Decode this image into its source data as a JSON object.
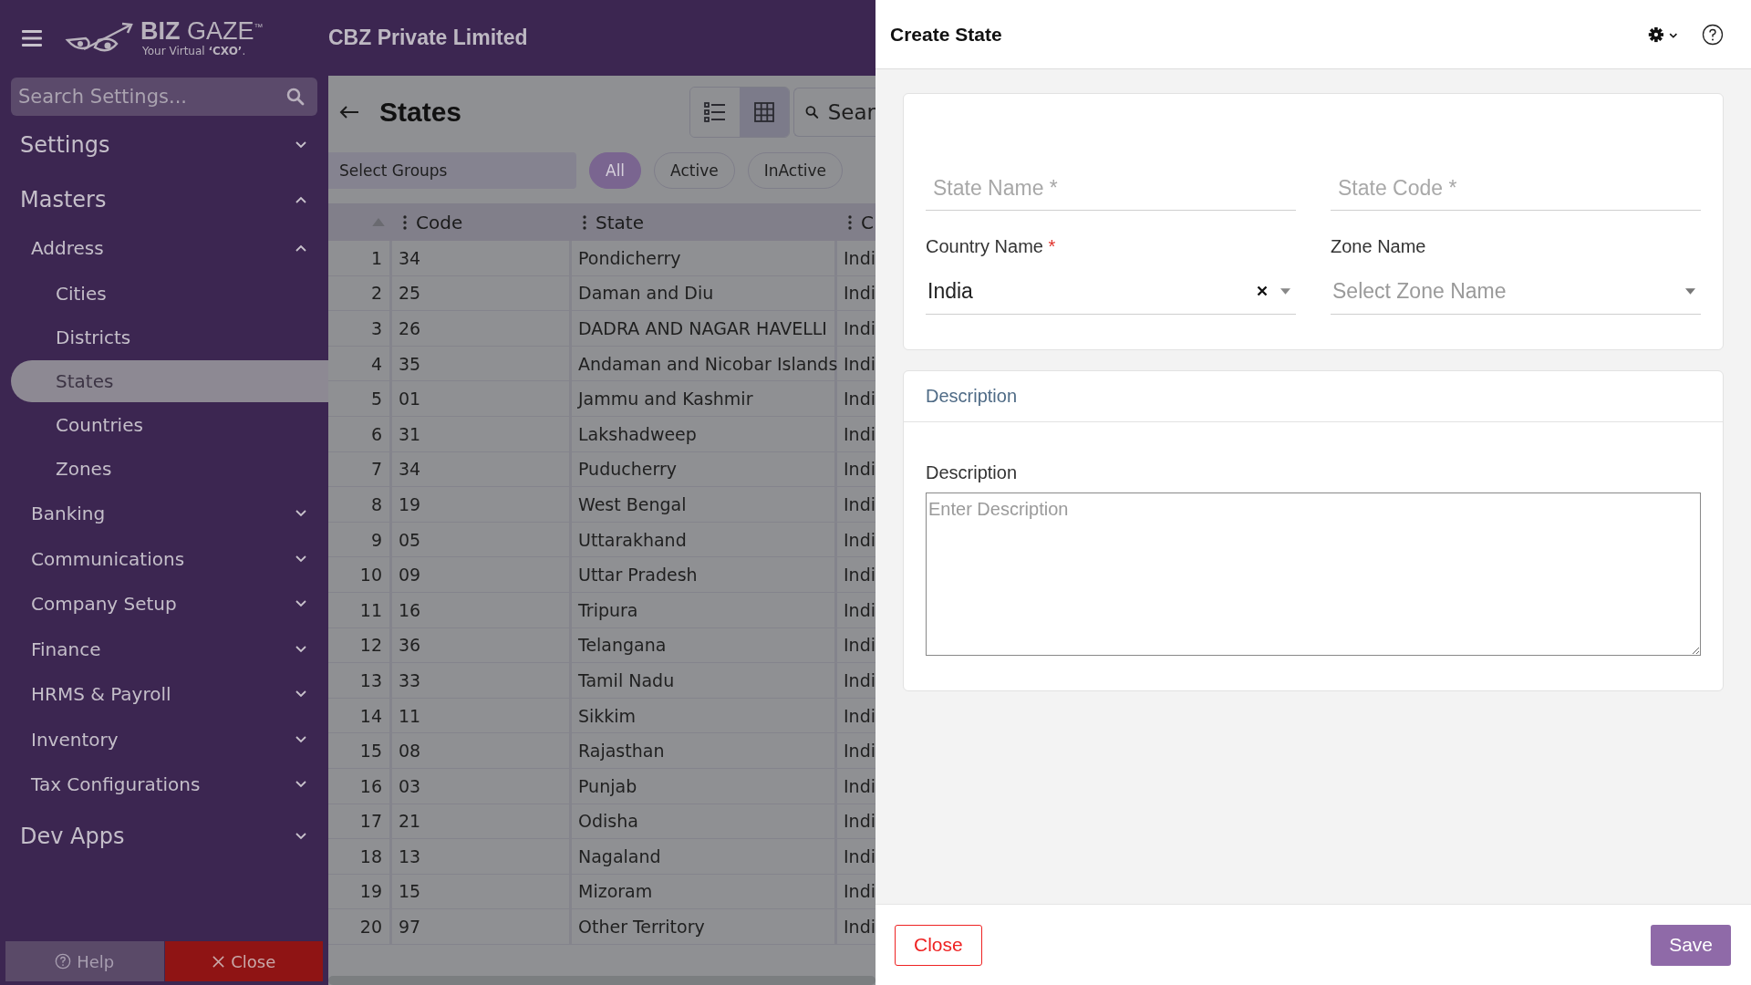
{
  "header": {
    "logo": "**BIZ** GAZE$^{™}$",
    "tagline": "Your Virtual **‘CXO’**.",
    "company": "CBZ Private Limited"
  },
  "sidebar": {
    "search": {
      "placeholder": "Search Settings..."
    },
    "sections": [
      {
        "label": "Settings",
        "expanded": false
      },
      {
        "label": "Masters",
        "expanded": true,
        "children": [
          {
            "label": "Address",
            "expanded": true,
            "children": [
              {
                "label": "Cities",
                "selected": false
              },
              {
                "label": "Districts",
                "selected": false
              },
              {
                "label": "States",
                "selected": true
              },
              {
                "label": "Countries",
                "selected": false
              },
              {
                "label": "Zones",
                "selected": false
              }
            ]
          },
          {
            "label": "Banking",
            "expanded": false
          },
          {
            "label": "Communications",
            "expanded": false
          },
          {
            "label": "Company Setup",
            "expanded": false
          },
          {
            "label": "Finance",
            "expanded": false
          },
          {
            "label": "HRMS & Payroll",
            "expanded": false
          },
          {
            "label": "Inventory",
            "expanded": false
          },
          {
            "label": "Tax Configurations",
            "expanded": false
          }
        ]
      },
      {
        "label": "Dev Apps",
        "expanded": false
      }
    ],
    "buttons": [
      {
        "label": "Help",
        "kind": "help"
      },
      {
        "label": "Close",
        "kind": "close"
      }
    ]
  },
  "main": {
    "title": "States",
    "views": [
      {
        "kind": "list",
        "selected": false
      },
      {
        "kind": "grid",
        "selected": true
      }
    ],
    "search": {
      "placeholder": "Sear"
    },
    "group_select": {
      "placeholder": "Select Groups"
    },
    "filters": [
      {
        "label": "All",
        "selected": true
      },
      {
        "label": "Active",
        "selected": false
      },
      {
        "label": "InActive",
        "selected": false
      }
    ],
    "table": {
      "columns": [
        "Code",
        "State",
        "C"
      ],
      "rows": [
        {
          "index": "1",
          "code": "34",
          "state": "Pondicherry",
          "column_3": "Indi"
        },
        {
          "index": "2",
          "code": "25",
          "state": "Daman and Diu",
          "column_3": "Indi"
        },
        {
          "index": "3",
          "code": "26",
          "state": "DADRA AND NAGAR HAVELLI",
          "column_3": "Indi"
        },
        {
          "index": "4",
          "code": "35",
          "state": "Andaman and Nicobar Islands",
          "column_3": "Indi"
        },
        {
          "index": "5",
          "code": "01",
          "state": "Jammu and Kashmir",
          "column_3": "Indi"
        },
        {
          "index": "6",
          "code": "31",
          "state": "Lakshadweep",
          "column_3": "Indi"
        },
        {
          "index": "7",
          "code": "34",
          "state": "Puducherry",
          "column_3": "Indi"
        },
        {
          "index": "8",
          "code": "19",
          "state": "West Bengal",
          "column_3": "Indi"
        },
        {
          "index": "9",
          "code": "05",
          "state": "Uttarakhand",
          "column_3": "Indi"
        },
        {
          "index": "10",
          "code": "09",
          "state": "Uttar Pradesh",
          "column_3": "Indi"
        },
        {
          "index": "11",
          "code": "16",
          "state": "Tripura",
          "column_3": "Indi"
        },
        {
          "index": "12",
          "code": "36",
          "state": "Telangana",
          "column_3": "Indi"
        },
        {
          "index": "13",
          "code": "33",
          "state": "Tamil Nadu",
          "column_3": "Indi"
        },
        {
          "index": "14",
          "code": "11",
          "state": "Sikkim",
          "column_3": "Indi"
        },
        {
          "index": "15",
          "code": "08",
          "state": "Rajasthan",
          "column_3": "Indi"
        },
        {
          "index": "16",
          "code": "03",
          "state": "Punjab",
          "column_3": "Indi"
        },
        {
          "index": "17",
          "code": "21",
          "state": "Odisha",
          "column_3": "Indi"
        },
        {
          "index": "18",
          "code": "13",
          "state": "Nagaland",
          "column_3": "Indi"
        },
        {
          "index": "19",
          "code": "15",
          "state": "Mizoram",
          "column_3": "Indi"
        },
        {
          "index": "20",
          "code": "97",
          "state": "Other Territory",
          "column_3": "Indi"
        }
      ]
    }
  },
  "drawer": {
    "title": "Create State",
    "state_name": {
      "placeholder": "State Name *"
    },
    "state_code": {
      "placeholder": "State Code *"
    },
    "country": {
      "label": "Country Name",
      "required_mark": "*",
      "value": "India"
    },
    "zone": {
      "label": "Zone Name",
      "placeholder": "Select Zone Name"
    },
    "description_section": {
      "title": "Description",
      "label": "Description",
      "placeholder": "Enter Description"
    },
    "buttons": [
      {
        "label": "Close",
        "kind": "close"
      },
      {
        "label": "Save",
        "kind": "save"
      }
    ]
  }
}
